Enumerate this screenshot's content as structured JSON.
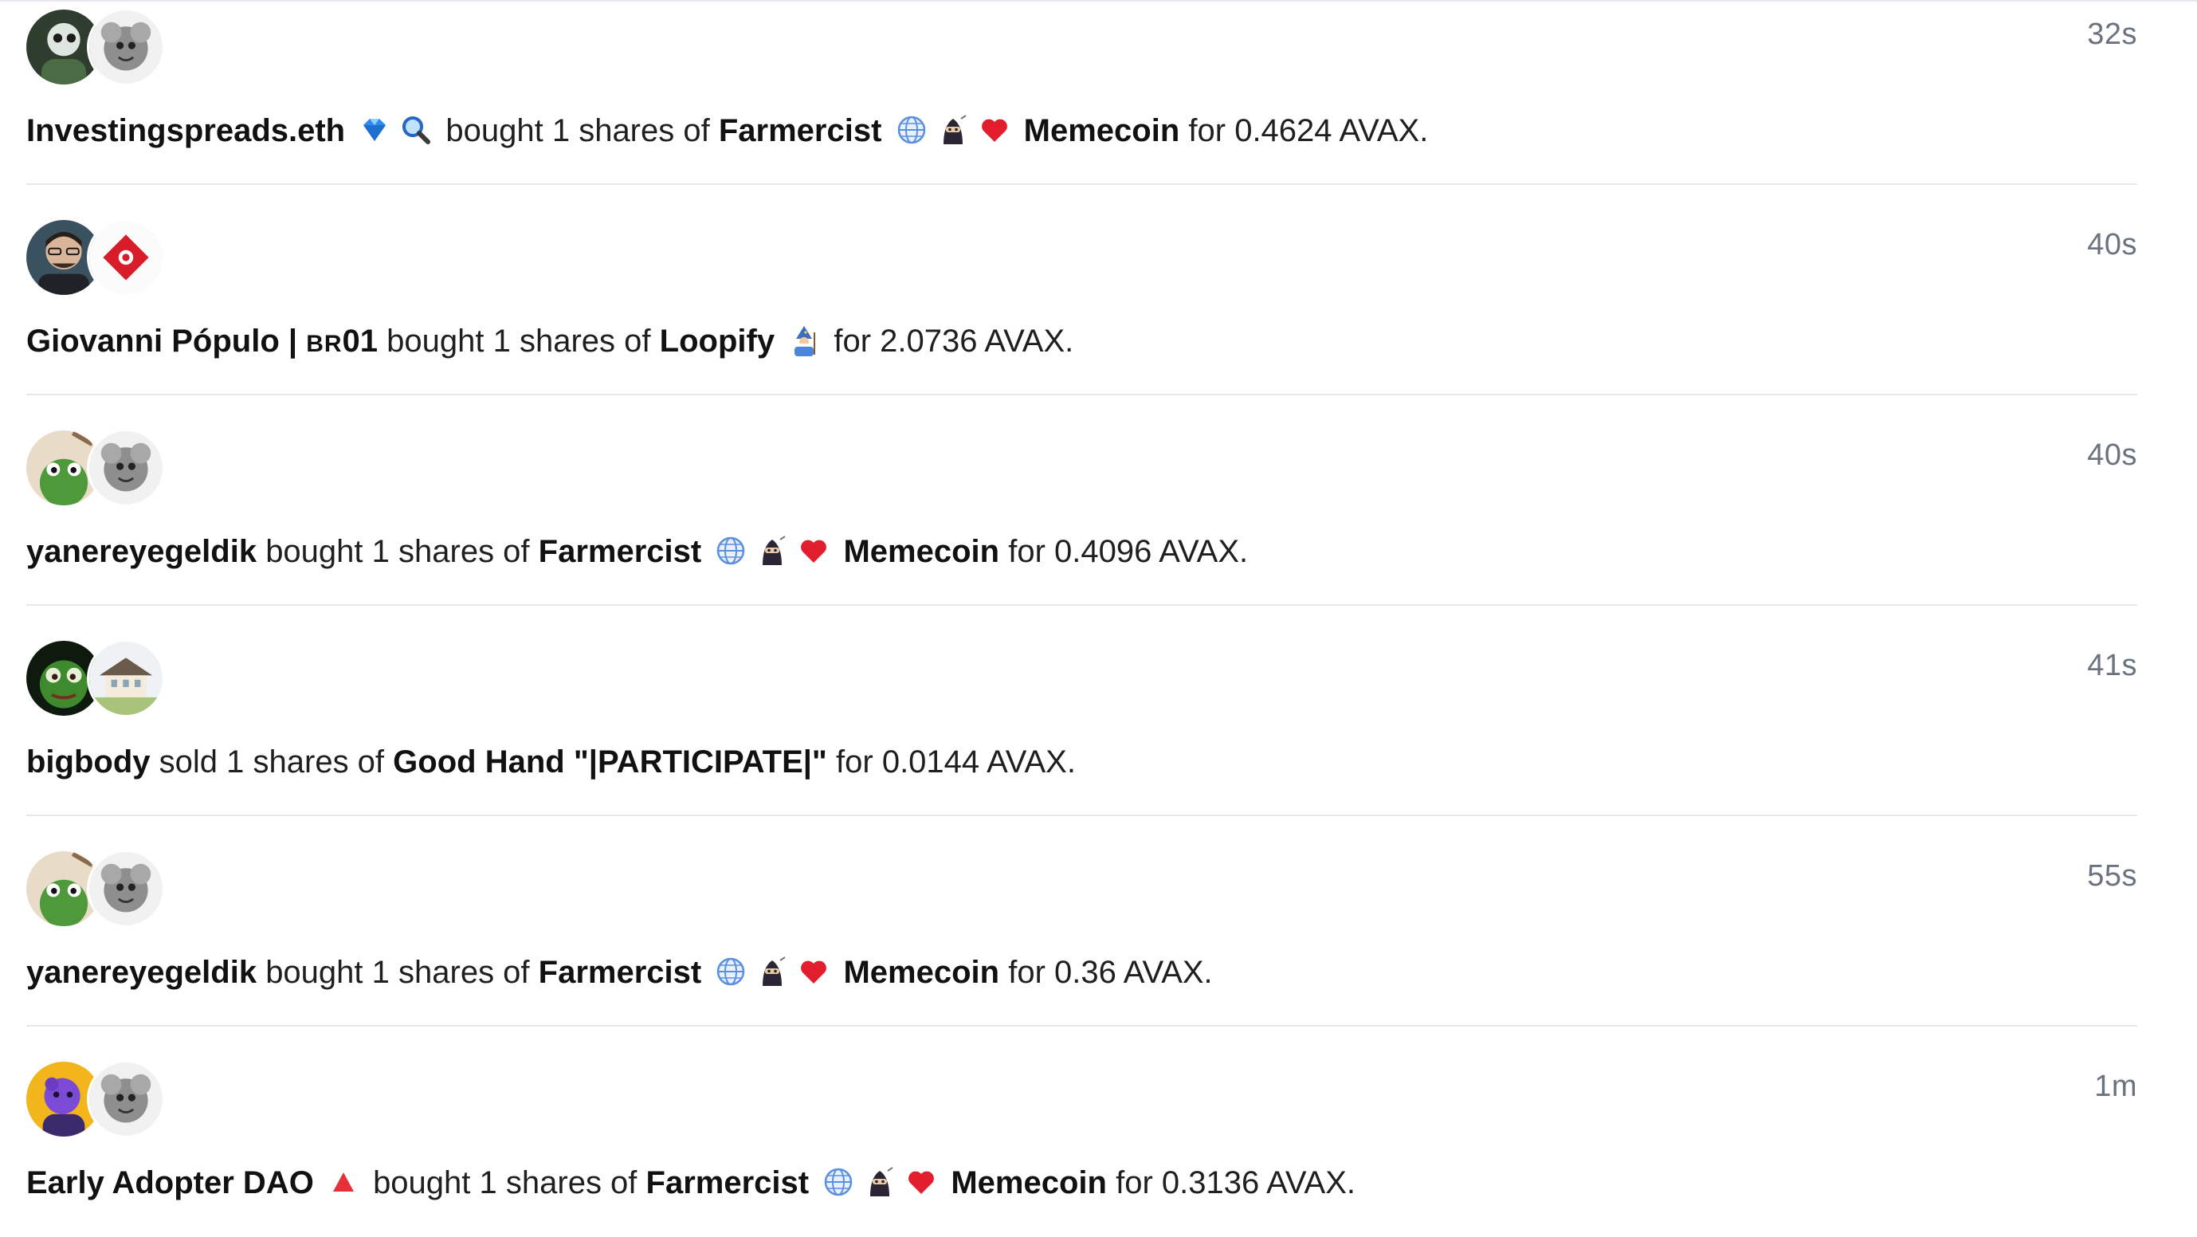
{
  "feed": [
    {
      "time": "32s",
      "user": "Investingspreads.eth",
      "user_badges": [
        "diamond-icon",
        "magnifier-icon"
      ],
      "action": "bought 1 shares of",
      "subject_parts": [
        "Farmercist",
        "Memecoin"
      ],
      "subject_badges": [
        "globe-icon",
        "ninja-icon",
        "heart-icon"
      ],
      "price_text": "for 0.4624 AVAX."
    },
    {
      "time": "40s",
      "user": "Giovanni Pópulo | ",
      "user_suffix_sc": "BR",
      "user_suffix": "01",
      "action": "bought 1 shares of",
      "subject": "Loopify",
      "subject_badges": [
        "wizard-icon"
      ],
      "price_text": "for 2.0736 AVAX."
    },
    {
      "time": "40s",
      "user": "yanereyegeldik",
      "action": "bought 1 shares of",
      "subject_parts": [
        "Farmercist",
        "Memecoin"
      ],
      "subject_badges": [
        "globe-icon",
        "ninja-icon",
        "heart-icon"
      ],
      "price_text": "for 0.4096 AVAX."
    },
    {
      "time": "41s",
      "user": "bigbody",
      "action": "sold 1 shares of",
      "subject": "Good Hand \"|PARTICIPATE|\"",
      "price_text": "for 0.0144 AVAX."
    },
    {
      "time": "55s",
      "user": "yanereyegeldik",
      "action": "bought 1 shares of",
      "subject_parts": [
        "Farmercist",
        "Memecoin"
      ],
      "subject_badges": [
        "globe-icon",
        "ninja-icon",
        "heart-icon"
      ],
      "price_text": "for 0.36 AVAX."
    },
    {
      "time": "1m",
      "user": "Early Adopter DAO",
      "user_badges": [
        "red-triangle-icon"
      ],
      "action": "bought 1 shares of",
      "subject_parts": [
        "Farmercist",
        "Memecoin"
      ],
      "subject_badges": [
        "globe-icon",
        "ninja-icon",
        "heart-icon"
      ],
      "price_text": "for 0.3136 AVAX."
    }
  ],
  "colors": {
    "text": "#111111",
    "muted": "#6b7280",
    "divider": "#e5e7eb",
    "heart": "#e11d2e",
    "diamond": "#2b8cf0"
  }
}
